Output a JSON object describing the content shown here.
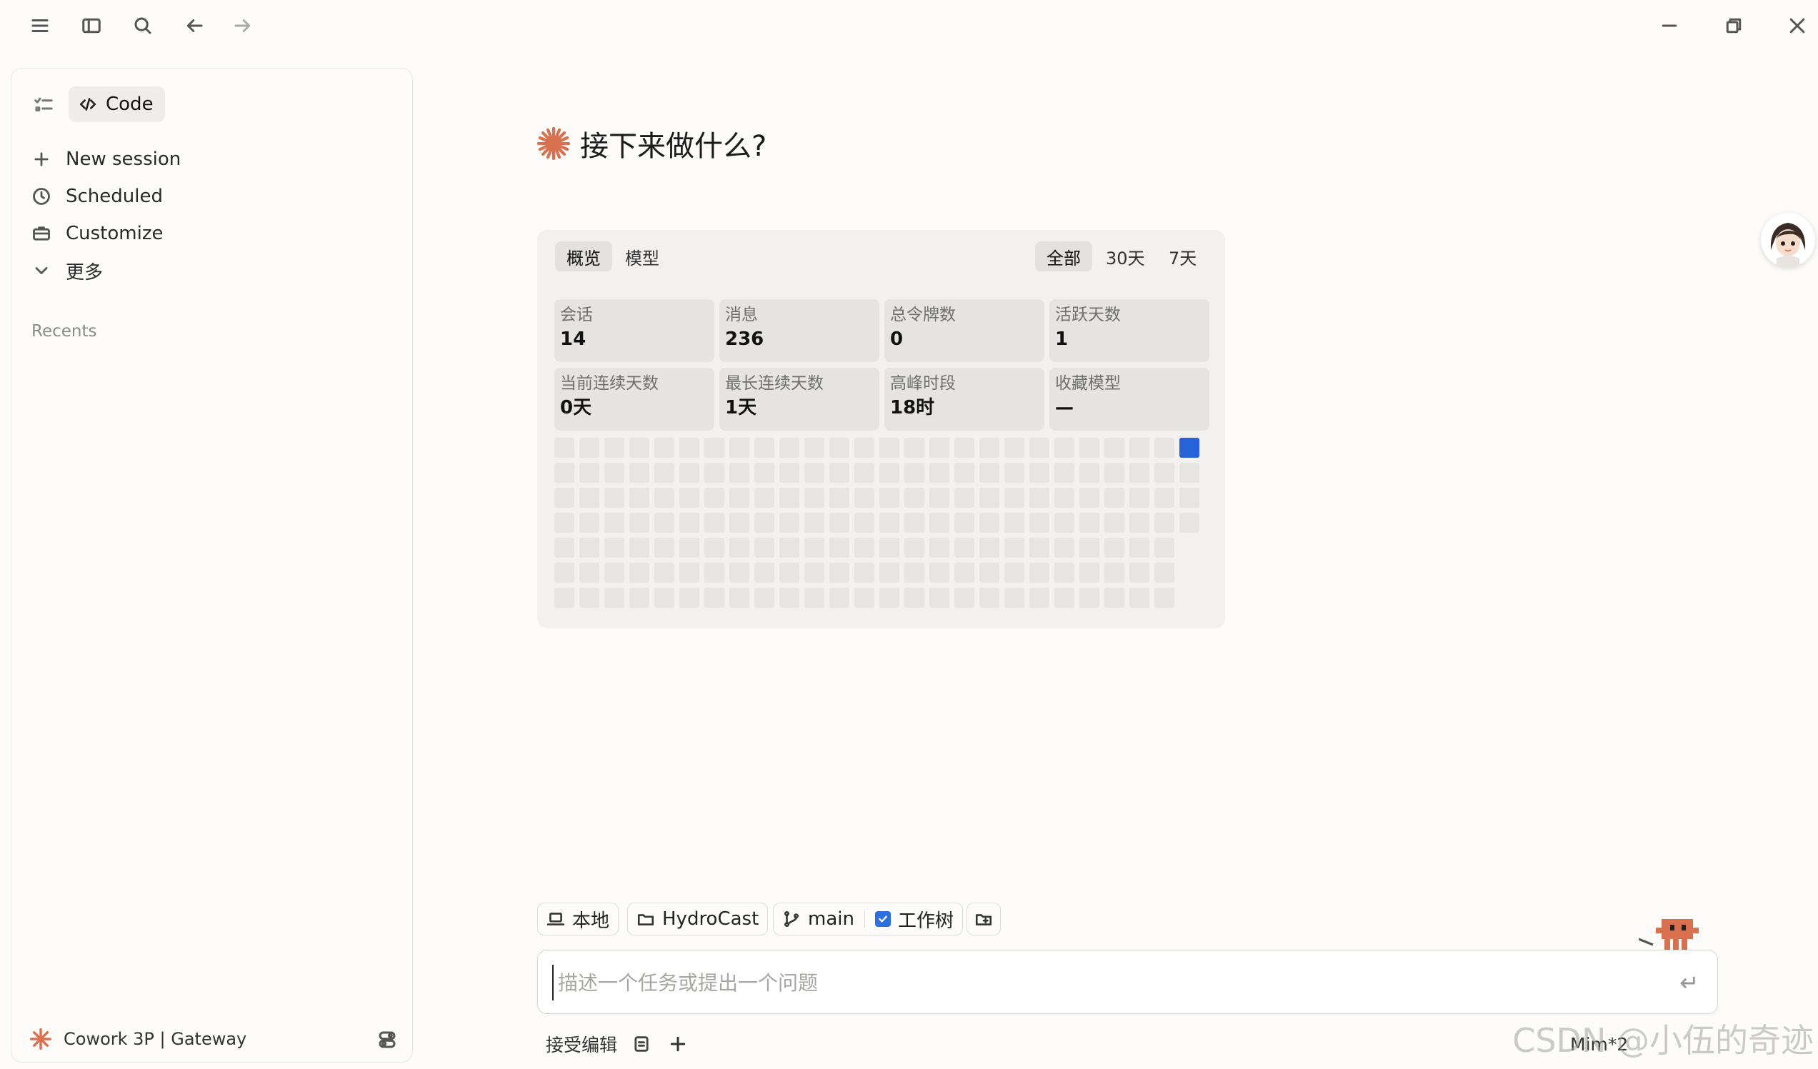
{
  "sidebar": {
    "code_label": "Code",
    "items": [
      {
        "label": "New session",
        "icon": "plus-icon"
      },
      {
        "label": "Scheduled",
        "icon": "clock-icon"
      },
      {
        "label": "Customize",
        "icon": "briefcase-icon"
      },
      {
        "label": "更多",
        "icon": "chevron-down-icon"
      }
    ],
    "recents_label": "Recents",
    "footer_label": "Cowork 3P | Gateway"
  },
  "heading": "接下来做什么?",
  "stats": {
    "tabs": [
      "概览",
      "模型"
    ],
    "active_tab": "概览",
    "ranges": [
      "全部",
      "30天",
      "7天"
    ],
    "active_range": "全部",
    "cards": [
      {
        "label": "会话",
        "value": "14"
      },
      {
        "label": "消息",
        "value": "236"
      },
      {
        "label": "总令牌数",
        "value": "0"
      },
      {
        "label": "活跃天数",
        "value": "1"
      },
      {
        "label": "当前连续天数",
        "value": "0天"
      },
      {
        "label": "最长连续天数",
        "value": "1天"
      },
      {
        "label": "高峰时段",
        "value": "18时"
      },
      {
        "label": "收藏模型",
        "value": "—"
      }
    ],
    "heatmap": {
      "weeks": 26,
      "last_week_days": 4,
      "active_week": 25,
      "active_day": 0,
      "empty_color": "#e6e5e2",
      "active_color": "#2563d6"
    }
  },
  "composer": {
    "chips": {
      "env": "本地",
      "folder": "HydroCast",
      "branch": "main",
      "worktree": "工作树"
    },
    "placeholder": "描述一个任务或提出一个问题",
    "accept_label": "接受编辑",
    "model_label": "Mim*2"
  },
  "colors": {
    "accent": "#d9704f",
    "blue": "#2b6fe0"
  },
  "watermark": "CSDN @小伍的奇迹"
}
